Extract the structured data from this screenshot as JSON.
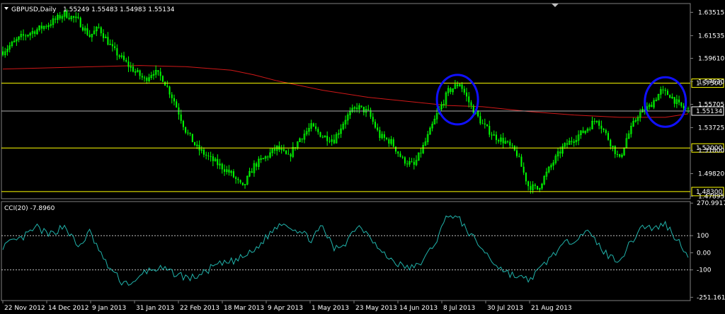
{
  "header": {
    "symbol": "GBPUSD,Daily",
    "ohlc": "1.55249 1.55483 1.54983 1.55134"
  },
  "colors": {
    "background": "#000000",
    "bull_candle": "#00ff00",
    "ma_line": "#d01818",
    "level_line": "#ffff00",
    "current_price_line": "#b0b0b0",
    "cci_line": "#20b2aa",
    "circle": "#1010ff",
    "grid_text": "#ffffff"
  },
  "chart_data": [
    {
      "type": "candlestick",
      "title": "GBPUSD,Daily",
      "ylim": [
        1.4775,
        1.642
      ],
      "price_ticks": [
        "1.63515",
        "1.61535",
        "1.59610",
        "1.57630",
        "1.55705",
        "1.53725",
        "1.51800",
        "1.49820",
        "1.47895"
      ],
      "x_labels": [
        "22 Nov 2012",
        "14 Dec 2012",
        "9 Jan 2013",
        "31 Jan 2013",
        "22 Feb 2013",
        "18 Mar 2013",
        "9 Apr 2013",
        "1 May 2013",
        "23 May 2013",
        "14 Jun 2013",
        "8 Jul 2013",
        "30 Jul 2013",
        "21 Aug 2013"
      ],
      "levels": [
        {
          "value": 1.575,
          "label": "1.57500"
        },
        {
          "value": 1.52,
          "label": "1.52000"
        },
        {
          "value": 1.483,
          "label": "1.48300"
        }
      ],
      "current_price": {
        "value": 1.55134,
        "label": "1.55134"
      },
      "close_path": [
        [
          0,
          1.602
        ],
        [
          8,
          1.614
        ],
        [
          20,
          1.625
        ],
        [
          27,
          1.634
        ],
        [
          33,
          1.628
        ],
        [
          38,
          1.615
        ],
        [
          42,
          1.622
        ],
        [
          48,
          1.604
        ],
        [
          55,
          1.59
        ],
        [
          62,
          1.578
        ],
        [
          66,
          1.585
        ],
        [
          70,
          1.579
        ],
        [
          75,
          1.56
        ],
        [
          80,
          1.535
        ],
        [
          85,
          1.52
        ],
        [
          90,
          1.512
        ],
        [
          95,
          1.505
        ],
        [
          100,
          1.498
        ],
        [
          105,
          1.486
        ],
        [
          110,
          1.505
        ],
        [
          115,
          1.512
        ],
        [
          120,
          1.52
        ],
        [
          125,
          1.512
        ],
        [
          130,
          1.528
        ],
        [
          135,
          1.538
        ],
        [
          140,
          1.53
        ],
        [
          145,
          1.527
        ],
        [
          150,
          1.545
        ],
        [
          155,
          1.555
        ],
        [
          160,
          1.55
        ],
        [
          165,
          1.53
        ],
        [
          170,
          1.525
        ],
        [
          175,
          1.51
        ],
        [
          180,
          1.505
        ],
        [
          185,
          1.525
        ],
        [
          190,
          1.548
        ],
        [
          195,
          1.568
        ],
        [
          200,
          1.575
        ],
        [
          205,
          1.555
        ],
        [
          210,
          1.54
        ],
        [
          215,
          1.53
        ],
        [
          220,
          1.525
        ],
        [
          225,
          1.515
        ],
        [
          230,
          1.488
        ],
        [
          234,
          1.485
        ],
        [
          240,
          1.505
        ],
        [
          245,
          1.52
        ],
        [
          250,
          1.528
        ],
        [
          255,
          1.535
        ],
        [
          260,
          1.545
        ],
        [
          265,
          1.528
        ],
        [
          270,
          1.51
        ],
        [
          273,
          1.528
        ],
        [
          278,
          1.548
        ],
        [
          283,
          1.555
        ],
        [
          288,
          1.568
        ],
        [
          292,
          1.565
        ],
        [
          296,
          1.556
        ],
        [
          300,
          1.552
        ]
      ],
      "ma_path": [
        [
          0,
          1.587
        ],
        [
          40,
          1.589
        ],
        [
          60,
          1.59
        ],
        [
          80,
          1.589
        ],
        [
          100,
          1.586
        ],
        [
          110,
          1.582
        ],
        [
          120,
          1.577
        ],
        [
          140,
          1.569
        ],
        [
          160,
          1.563
        ],
        [
          180,
          1.559
        ],
        [
          195,
          1.556
        ],
        [
          210,
          1.555
        ],
        [
          230,
          1.551
        ],
        [
          250,
          1.548
        ],
        [
          270,
          1.546
        ],
        [
          290,
          1.546
        ],
        [
          300,
          1.549
        ]
      ],
      "circles": [
        {
          "x": 199,
          "y": 1.561,
          "label": ""
        },
        {
          "x": 290,
          "y": 1.559,
          "label": ""
        }
      ]
    },
    {
      "type": "line",
      "title": "CCI(20) -7.8960",
      "ylim": [
        -275,
        295
      ],
      "ticks": [
        "270.9917",
        "100",
        "0.00",
        "-100",
        "-251.1611"
      ],
      "levels": [
        100,
        -100
      ],
      "series": [
        {
          "name": "CCI(20)",
          "path": [
            [
              0,
              40
            ],
            [
              8,
              80
            ],
            [
              15,
              150
            ],
            [
              20,
              100
            ],
            [
              27,
              160
            ],
            [
              33,
              30
            ],
            [
              38,
              120
            ],
            [
              45,
              -60
            ],
            [
              52,
              -170
            ],
            [
              58,
              -180
            ],
            [
              62,
              -110
            ],
            [
              68,
              -90
            ],
            [
              75,
              -120
            ],
            [
              82,
              -150
            ],
            [
              88,
              -120
            ],
            [
              92,
              -80
            ],
            [
              98,
              -60
            ],
            [
              103,
              -40
            ],
            [
              110,
              10
            ],
            [
              116,
              100
            ],
            [
              122,
              180
            ],
            [
              128,
              140
            ],
            [
              135,
              80
            ],
            [
              140,
              150
            ],
            [
              145,
              20
            ],
            [
              150,
              60
            ],
            [
              155,
              160
            ],
            [
              160,
              120
            ],
            [
              165,
              10
            ],
            [
              170,
              -40
            ],
            [
              175,
              -80
            ],
            [
              180,
              -90
            ],
            [
              185,
              -30
            ],
            [
              190,
              80
            ],
            [
              195,
              230
            ],
            [
              200,
              190
            ],
            [
              205,
              100
            ],
            [
              210,
              20
            ],
            [
              215,
              -60
            ],
            [
              220,
              -110
            ],
            [
              225,
              -140
            ],
            [
              230,
              -160
            ],
            [
              235,
              -100
            ],
            [
              240,
              -20
            ],
            [
              245,
              40
            ],
            [
              250,
              80
            ],
            [
              255,
              130
            ],
            [
              260,
              60
            ],
            [
              265,
              -20
            ],
            [
              270,
              -40
            ],
            [
              275,
              60
            ],
            [
              280,
              160
            ],
            [
              285,
              140
            ],
            [
              290,
              170
            ],
            [
              295,
              80
            ],
            [
              300,
              -8
            ]
          ]
        }
      ]
    }
  ]
}
